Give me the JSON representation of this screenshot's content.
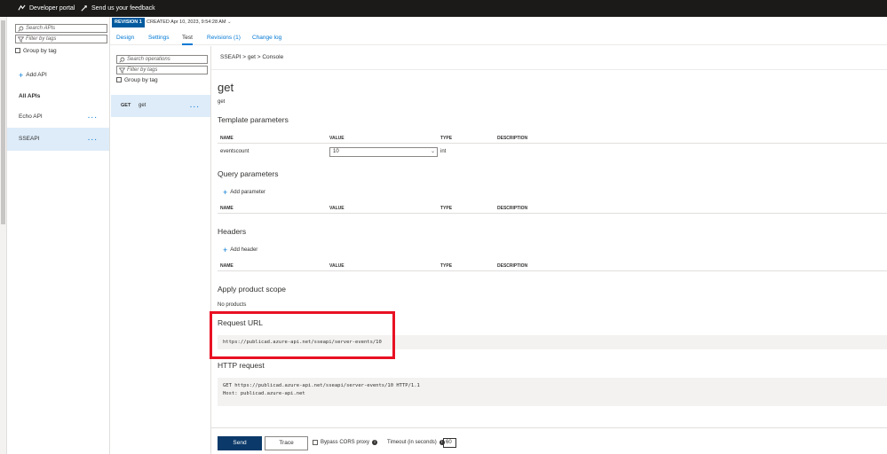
{
  "topbar": {
    "developer_portal": "Developer portal",
    "feedback": "Send us your feedback"
  },
  "api_pane": {
    "search_placeholder": "Search APIs",
    "filter_placeholder": "Filter by tags",
    "group_by_tag": "Group by tag",
    "add_api": "Add API",
    "all_apis": "All APIs",
    "apis": [
      {
        "name": "Echo API",
        "more": "..."
      },
      {
        "name": "SSEAPI",
        "more": "..."
      }
    ]
  },
  "revision": {
    "badge": "REVISION 1",
    "created": "CREATED Apr 10, 2023, 9:54:28 AM"
  },
  "tabs": [
    "Design",
    "Settings",
    "Test",
    "Revisions (1)",
    "Change log"
  ],
  "operations": {
    "search_placeholder": "Search operations",
    "filter_placeholder": "Filter by tags",
    "group_by_tag": "Group by tag",
    "items": [
      {
        "method": "GET",
        "name": "get",
        "more": "..."
      }
    ]
  },
  "console": {
    "breadcrumb": "SSEAPI > get > Console",
    "title": "get",
    "subtitle": "get",
    "template_parameters": {
      "heading": "Template parameters",
      "columns": [
        "NAME",
        "VALUE",
        "TYPE",
        "DESCRIPTION"
      ],
      "rows": [
        {
          "name": "eventscount",
          "value": "10",
          "type": "int",
          "description": ""
        }
      ]
    },
    "query_parameters": {
      "heading": "Query parameters",
      "add": "Add parameter",
      "columns": [
        "NAME",
        "VALUE",
        "TYPE",
        "DESCRIPTION"
      ]
    },
    "headers": {
      "heading": "Headers",
      "add": "Add header",
      "columns": [
        "NAME",
        "VALUE",
        "TYPE",
        "DESCRIPTION"
      ]
    },
    "product_scope": {
      "heading": "Apply product scope",
      "value": "No products"
    },
    "request_url": {
      "heading": "Request URL",
      "value": "https://publicad.azure-api.net/sseapi/server-events/10"
    },
    "http_request": {
      "heading": "HTTP request",
      "line1": "GET https://publicad.azure-api.net/sseapi/server-events/10 HTTP/1.1",
      "line2": "Host: publicad.azure-api.net"
    }
  },
  "footer": {
    "send": "Send",
    "trace": "Trace",
    "bypass": "Bypass CORS proxy",
    "info": "i",
    "timeout_label": "Timeout (in seconds)",
    "timeout_value": "60"
  },
  "colors": {
    "accent": "#0078d4",
    "highlight": "#e81123",
    "send_button": "#0b3a6a"
  }
}
